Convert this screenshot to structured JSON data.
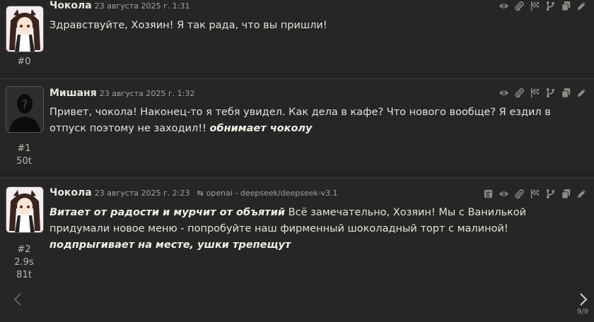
{
  "messages": [
    {
      "name": "Чокола",
      "date": "23 августа 2025 г. 1:31",
      "index": "#0",
      "text_parts": [
        {
          "text": "Здравствуйте, Хозяин! Я так рада, что вы пришли!",
          "italic": false
        }
      ]
    },
    {
      "name": "Мишаня",
      "date": "23 августа 2025 г. 1:32",
      "index": "#1",
      "tokens": "50t",
      "text_parts": [
        {
          "text": "Привет, чокола! Наконец-то я тебя увидел. Как дела в кафе? Что нового вообще? Я ездил в отпуск поэтому не заходил!! ",
          "italic": false
        },
        {
          "text": "обнимает чоколу",
          "italic": true
        }
      ]
    },
    {
      "name": "Чокола",
      "date": "23 августа 2025 г. 2:23",
      "model": "openai - deepseek/deepseek-v3.1",
      "index": "#2",
      "time": "2.9s",
      "tokens": "81t",
      "text_parts": [
        {
          "text": "Витает от радости и мурчит от объятий",
          "italic": true
        },
        {
          "text": " Всё замечательно, Хозяин! Мы с Ванилькой придумали новое меню - попробуйте наш фирменный шоколадный торт с малиной!",
          "italic": false
        },
        {
          "text": "BR",
          "italic": false
        },
        {
          "text": "подпрыгивает на месте, ушки трепещут",
          "italic": true
        }
      ]
    }
  ],
  "toolbar_icons": [
    "eye-icon",
    "paperclip-icon",
    "flag-icon",
    "branch-icon",
    "copy-icon",
    "edit-icon"
  ],
  "extra_icon_last": "reasoning-icon",
  "swipe_counter": "9/9",
  "colors": {
    "background": "#242424",
    "text": "#e4e4da",
    "icon": "#8c8c85"
  }
}
